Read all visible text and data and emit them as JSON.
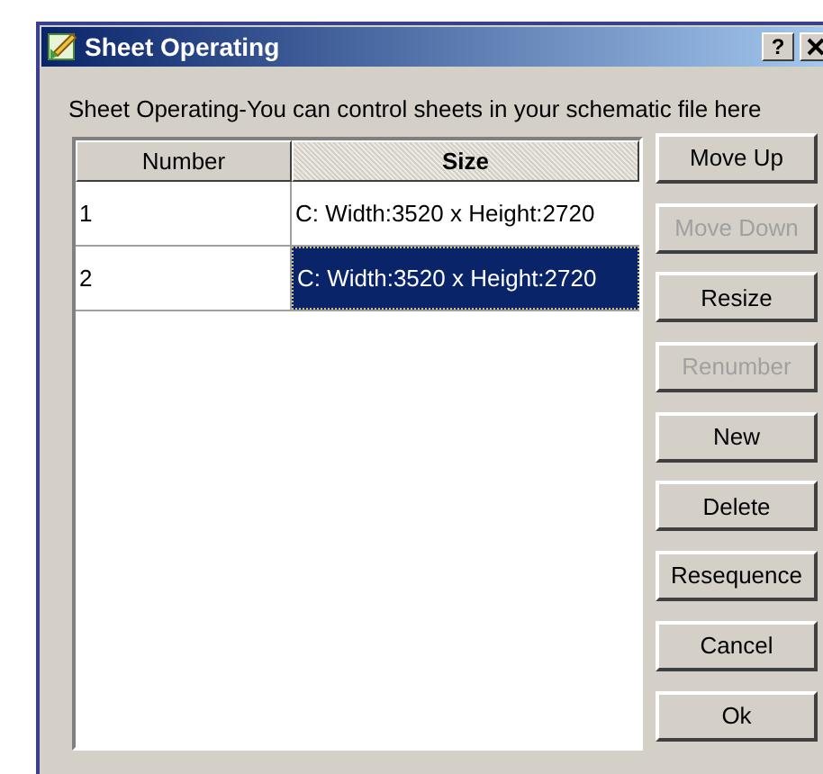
{
  "window": {
    "title": "Sheet Operating",
    "help": "?"
  },
  "description": "Sheet Operating-You can control sheets in your schematic file here",
  "table": {
    "columns": [
      "Number",
      "Size"
    ],
    "rows": [
      {
        "number": "1",
        "size": "C: Width:3520 x Height:2720",
        "selected": false
      },
      {
        "number": "2",
        "size": "C: Width:3520 x Height:2720",
        "selected": true
      }
    ]
  },
  "buttons": [
    {
      "label": "Move Up",
      "disabled": false
    },
    {
      "label": "Move Down",
      "disabled": true
    },
    {
      "label": "Resize",
      "disabled": false
    },
    {
      "label": "Renumber",
      "disabled": true
    },
    {
      "label": "New",
      "disabled": false
    },
    {
      "label": "Delete",
      "disabled": false
    },
    {
      "label": "Resequence",
      "disabled": false
    },
    {
      "label": "Cancel",
      "disabled": false
    },
    {
      "label": "Ok",
      "disabled": false
    }
  ]
}
